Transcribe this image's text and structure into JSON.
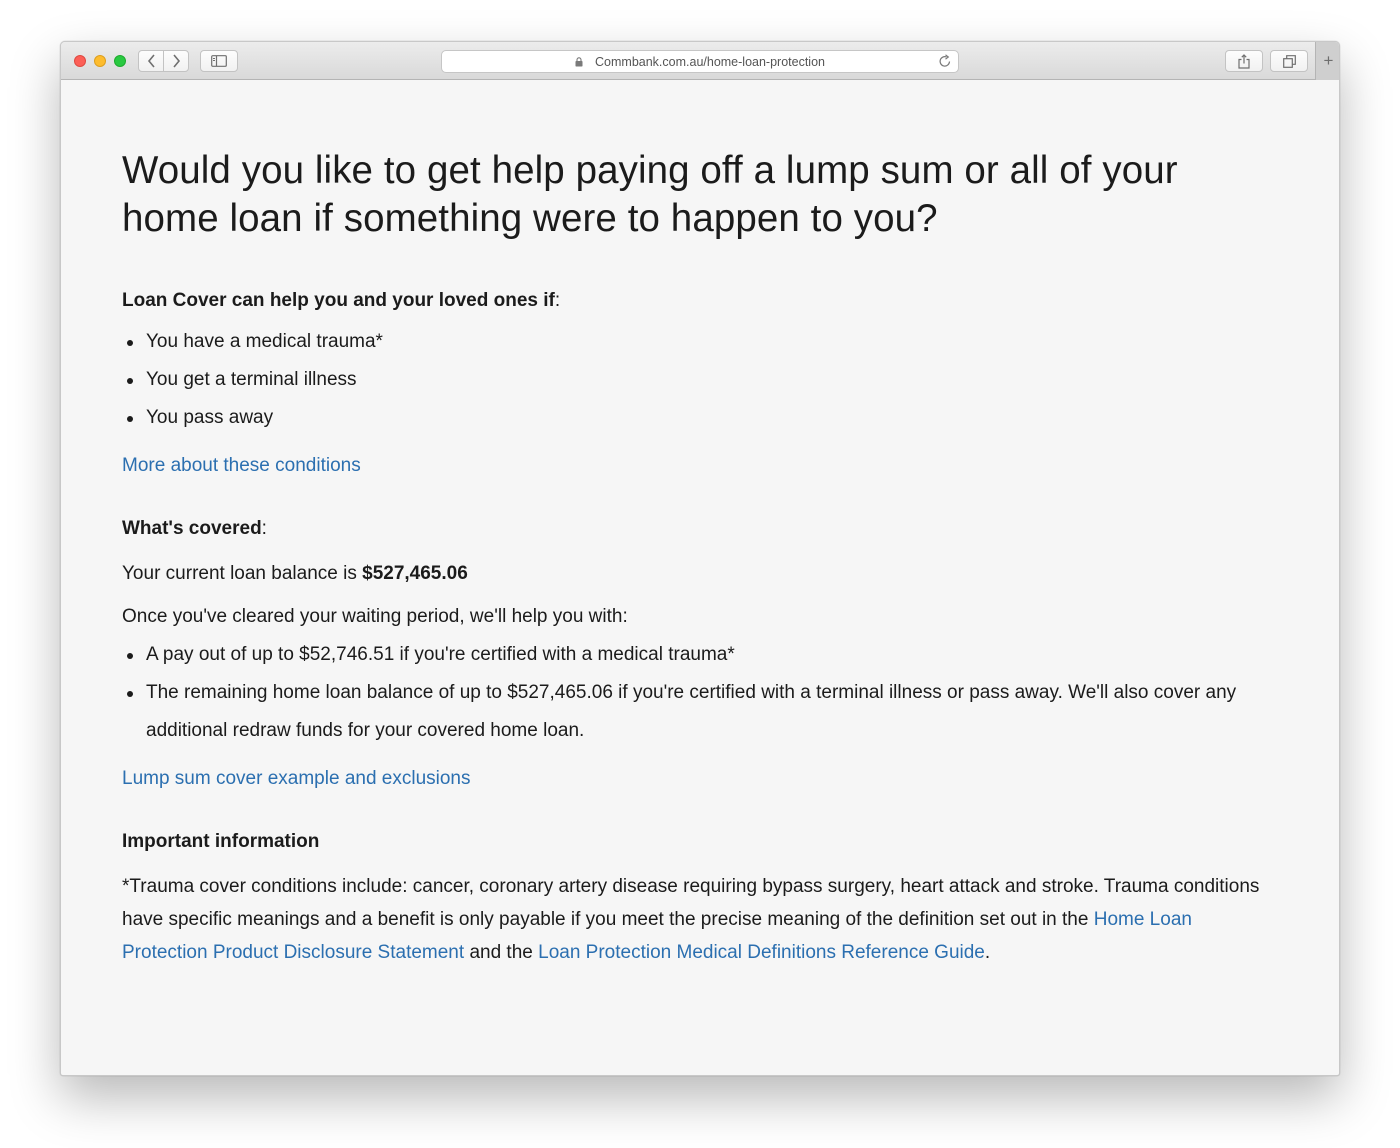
{
  "browser": {
    "url": "Commbank.com.au/home-loan-protection",
    "new_tab_symbol": "+"
  },
  "page": {
    "heading": "Would you like to get help paying off a lump sum or all of your home loan if something were to happen to you?",
    "help_title": "Loan Cover can help you and your loved ones if",
    "help_title_colon": ":",
    "conditions": [
      "You have a medical trauma*",
      "You get a terminal illness",
      "You pass away"
    ],
    "conditions_link": "More about these conditions",
    "covered_title": "What's covered",
    "covered_title_colon": ":",
    "balance_prefix": "Your current loan balance is ",
    "balance_value": "$527,465.06",
    "waiting_text": "Once you've cleared your waiting period, we'll help you with:",
    "cover_items": [
      "A pay out of up to $52,746.51 if you're certified with a medical trauma*",
      "The remaining home loan balance of up to $527,465.06 if you're certified with a terminal illness or pass away. We'll also cover any additional redraw funds for your covered home loan."
    ],
    "lump_sum_link": "Lump sum cover example and exclusions",
    "important_title": "Important information",
    "trauma_text": "*Trauma cover conditions include: cancer, coronary artery disease requiring bypass surgery, heart attack and stroke. Trauma conditions have specific meanings and a benefit is only payable if you meet the precise meaning of the definition set out in the ",
    "pds_link": "Home Loan Protection Product Disclosure Statement",
    "and_the": " and the ",
    "guide_link": "Loan Protection Medical Definitions Reference Guide",
    "final_period": "."
  },
  "colors": {
    "link": "#2b6fb0",
    "text": "#1b1b1b",
    "background": "#f6f6f6"
  }
}
